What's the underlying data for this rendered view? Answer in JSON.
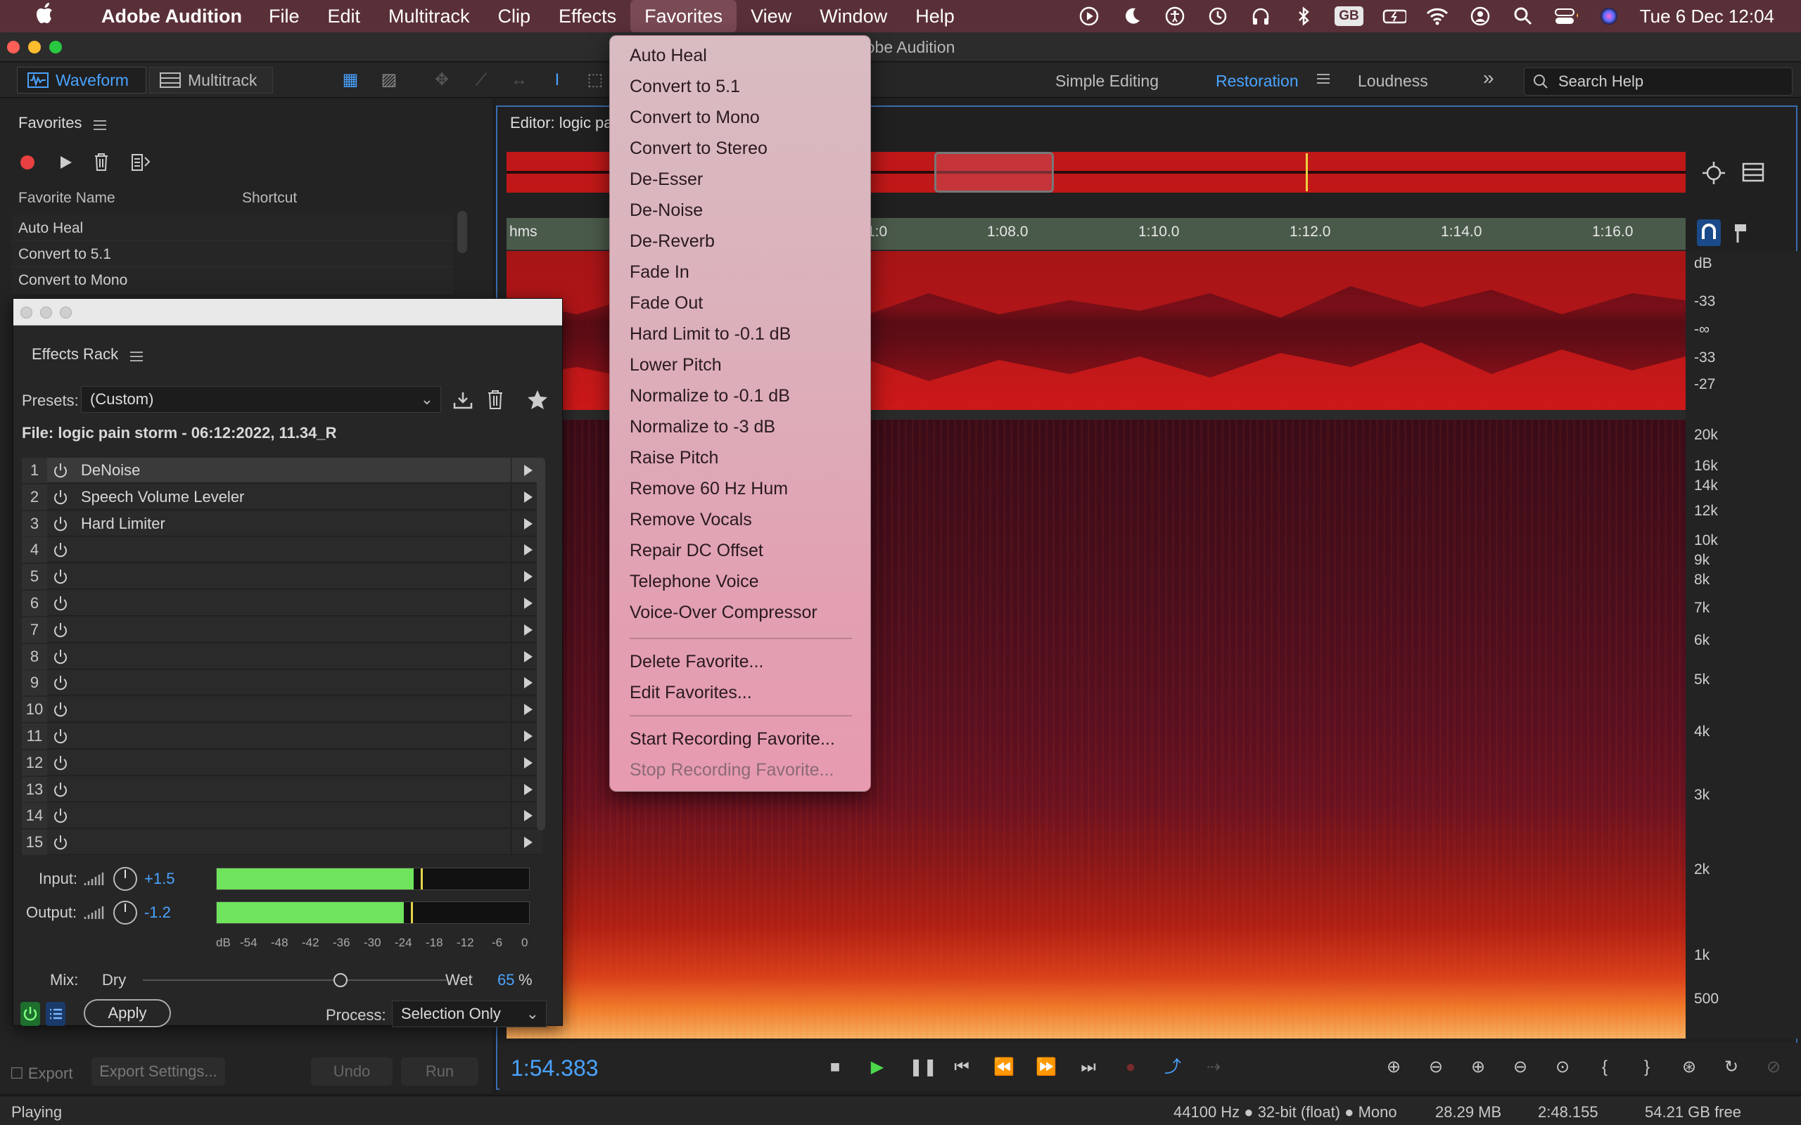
{
  "menubar": {
    "app_name": "Adobe Audition",
    "items": [
      "File",
      "Edit",
      "Multitrack",
      "Clip",
      "Effects",
      "Favorites",
      "View",
      "Window",
      "Help"
    ],
    "active_item": "Favorites",
    "keyboard_layout": "GB",
    "datetime": "Tue 6 Dec  12:04"
  },
  "window": {
    "title": "Adobe Audition"
  },
  "toolbar": {
    "waveform_label": "Waveform",
    "multitrack_label": "Multitrack",
    "workspaces": [
      "Simple Editing",
      "Restoration",
      "Loudness"
    ],
    "active_workspace": "Restoration",
    "search_placeholder": "Search Help"
  },
  "favorites_panel": {
    "title": "Favorites",
    "col_name": "Favorite Name",
    "col_shortcut": "Shortcut",
    "rows": [
      "Auto Heal",
      "Convert to 5.1",
      "Convert to Mono"
    ]
  },
  "effects_rack": {
    "title": "Effects Rack",
    "presets_label": "Presets:",
    "preset_value": "(Custom)",
    "file_label": "File: logic pain storm  - 06:12:2022, 11.34_R",
    "slots": [
      {
        "num": "1",
        "name": "DeNoise"
      },
      {
        "num": "2",
        "name": "Speech Volume Leveler"
      },
      {
        "num": "3",
        "name": "Hard Limiter"
      },
      {
        "num": "4",
        "name": ""
      },
      {
        "num": "5",
        "name": ""
      },
      {
        "num": "6",
        "name": ""
      },
      {
        "num": "7",
        "name": ""
      },
      {
        "num": "8",
        "name": ""
      },
      {
        "num": "9",
        "name": ""
      },
      {
        "num": "10",
        "name": ""
      },
      {
        "num": "11",
        "name": ""
      },
      {
        "num": "12",
        "name": ""
      },
      {
        "num": "13",
        "name": ""
      },
      {
        "num": "14",
        "name": ""
      },
      {
        "num": "15",
        "name": ""
      }
    ],
    "input_label": "Input:",
    "input_value": "+1.5",
    "input_level": 0.63,
    "output_label": "Output:",
    "output_value": "-1.2",
    "output_level": 0.6,
    "meter_scale": [
      "dB",
      "-54",
      "-48",
      "-42",
      "-36",
      "-30",
      "-24",
      "-18",
      "-12",
      "-6",
      "0"
    ],
    "mix_label": "Mix:",
    "dry_label": "Dry",
    "wet_label": "Wet",
    "wet_value": "65",
    "wet_unit": "%",
    "wet_fraction": 0.65,
    "apply_label": "Apply",
    "process_label": "Process:",
    "process_value": "Selection Only"
  },
  "panel_footer": {
    "export_label": "Export",
    "export_settings_label": "Export Settings...",
    "undo_label": "Undo",
    "run_label": "Run"
  },
  "editor": {
    "title": "Editor: logic pa",
    "time_unit": "hms",
    "time_ticks": [
      "1:0",
      "1:08.0",
      "1:10.0",
      "1:12.0",
      "1:14.0",
      "1:16.0"
    ],
    "db_labels": [
      "dB",
      "-33",
      "-∞",
      "-33",
      "-27"
    ],
    "freq_labels": [
      "20k",
      "16k",
      "14k",
      "12k",
      "10k",
      "9k",
      "8k",
      "7k",
      "6k",
      "5k",
      "4k",
      "3k",
      "2k",
      "1k",
      "500"
    ],
    "timecode": "1:54.383"
  },
  "favorites_menu": {
    "items": [
      "Auto Heal",
      "Convert to 5.1",
      "Convert to Mono",
      "Convert to Stereo",
      "De-Esser",
      "De-Noise",
      "De-Reverb",
      "Fade In",
      "Fade Out",
      "Hard Limit to -0.1 dB",
      "Lower Pitch",
      "Normalize to -0.1 dB",
      "Normalize to -3 dB",
      "Raise Pitch",
      "Remove 60 Hz Hum",
      "Remove Vocals",
      "Repair DC Offset",
      "Telephone Voice",
      "Voice-Over Compressor"
    ],
    "manage_items": [
      "Delete Favorite...",
      "Edit Favorites..."
    ],
    "recording_items": [
      "Start Recording Favorite...",
      "Stop Recording Favorite..."
    ]
  },
  "statusbar": {
    "state": "Playing",
    "sample_info": "44100 Hz ● 32-bit (float) ● Mono",
    "size": "28.29 MB",
    "duration": "2:48.155",
    "free": "54.21 GB free"
  },
  "colors": {
    "accent": "#4aa3ff",
    "meter_green": "#6fe35b",
    "record_red": "#e84040",
    "waveform_red": "#c01818"
  }
}
